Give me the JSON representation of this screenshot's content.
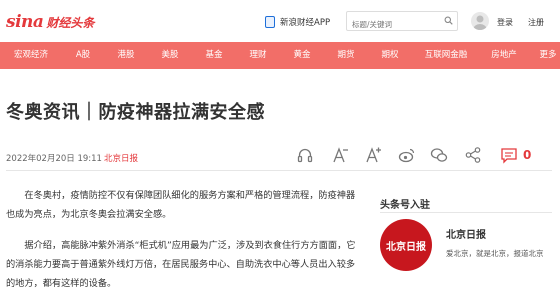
{
  "header": {
    "logo_brand": "sina",
    "logo_text": "财经头条",
    "app_link": "新浪财经APP",
    "search_placeholder": "标题/关键词",
    "login": "登录",
    "register": "注册"
  },
  "nav": {
    "items": [
      "宏观经济",
      "A股",
      "港股",
      "美股",
      "基金",
      "理财",
      "黄金",
      "期货",
      "期权",
      "互联网金融",
      "房地产",
      "更多"
    ]
  },
  "article": {
    "title": "冬奥资讯｜防疫神器拉满安全感",
    "date": "2022年02月20日 19:11",
    "source": "北京日报",
    "comment_count": "0",
    "paragraphs": [
      "在冬奥村，疫情防控不仅有保障团队细化的服务方案和严格的管理流程，防疫神器也成为亮点，为北京冬奥会拉满安全感。",
      "据介绍，高能脉冲紫外消杀“柜式机”应用最为广泛，涉及到衣食住行方方面面，它的消杀能力要高于普通紫外线灯万倍，在居民服务中心、自助洗衣中心等人员出入较多的地方，都有这样的设备。"
    ]
  },
  "sidebar": {
    "title": "头条号入驻",
    "account_logo_text": "北京日报",
    "account_name": "北京日报",
    "account_desc": "爱北京，就是北京，报道北京"
  },
  "colors": {
    "accent": "#e4393c",
    "nav_bg": "#f26e68"
  },
  "icons": [
    "search-icon",
    "phone-icon",
    "headphones-icon",
    "font-decrease-icon",
    "font-increase-icon",
    "weibo-icon",
    "wechat-icon",
    "share-icon",
    "comment-icon"
  ]
}
